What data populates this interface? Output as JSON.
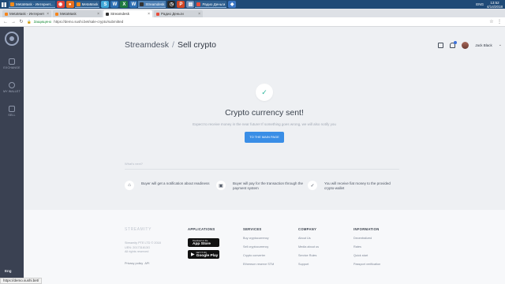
{
  "taskbar": {
    "tasks": [
      {
        "label": "MetaMask - Интернет..."
      },
      {
        "label": "MetaMask"
      },
      {
        "label": "Streamdesk"
      },
      {
        "label": "Радио Деньги"
      }
    ],
    "lang": "ENG",
    "time": "13:52",
    "date": "4/14/2018"
  },
  "browser": {
    "tabs": [
      {
        "label": "MetaMask - Интернет"
      },
      {
        "label": "MetaMask"
      },
      {
        "label": "Streamdesk"
      },
      {
        "label": "Радио Деньги"
      }
    ],
    "secure_label": "Защищено",
    "url": "https://demo.sushi.bet/sale-crypto/submitted",
    "status_url": "https://demo.sushi.bet/"
  },
  "sidebar": {
    "items": [
      {
        "label": "EXCHANGE"
      },
      {
        "label": "MY WALLET"
      },
      {
        "label": "SELL"
      }
    ],
    "user_short": "Eng"
  },
  "header": {
    "brand": "Streamdesk",
    "separator": "/",
    "page": "Sell crypto",
    "username": "Jack Black"
  },
  "success": {
    "title": "Crypto currency sent!",
    "subtitle": "Expect to receive money in the near future! If something goes wrong, we will also notify you",
    "button": "TO THE MAIN PAGE"
  },
  "next": {
    "label": "What's next?",
    "steps": [
      {
        "text": "Buyer will get a notification about readiness"
      },
      {
        "text": "Buyer will pay for the transaction through the payment system"
      },
      {
        "text": "You will receive fiat money to the provided crypto-wallet"
      }
    ]
  },
  "footer": {
    "logo": "STREAMITY",
    "company_lines": [
      "Streamity PTE LTD © 2018",
      "UEN: 201731813G",
      "All rights reserved"
    ],
    "privacy": "Privacy policy",
    "api": "API",
    "applications": {
      "title": "APPLICATIONS",
      "appstore_small": "Download on the",
      "appstore": "App Store",
      "googleplay_small": "GET IT ON",
      "googleplay": "Google Play"
    },
    "services": {
      "title": "SERVICES",
      "links": [
        "Buy cryptocurrency",
        "Sell cryptocurrency",
        "Crypto converter",
        "Ethereum reserve STM"
      ]
    },
    "company": {
      "title": "COMPANY",
      "links": [
        "About Us",
        "Media about us",
        "Service Rules",
        "Support"
      ]
    },
    "information": {
      "title": "INFORMATION",
      "links": [
        "Decentralized",
        "Rates",
        "Quick start",
        "Passport verification"
      ]
    }
  },
  "colors": {
    "accent": "#3a8ee6",
    "sidebar": "#3a4152",
    "success": "#2bb59c"
  }
}
